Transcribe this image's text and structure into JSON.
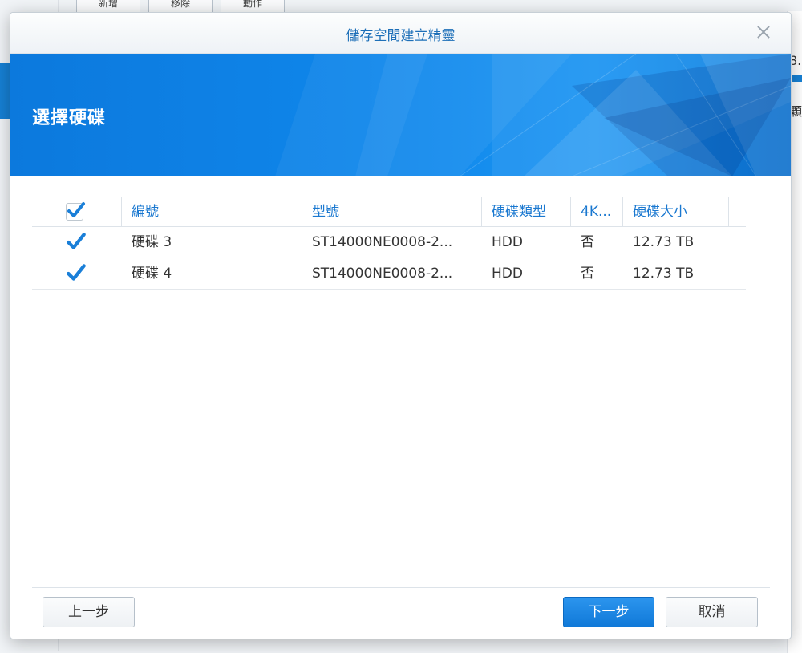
{
  "background": {
    "toolbar_buttons": [
      "新增",
      "移除",
      "動作"
    ],
    "right_text_1": "8.",
    "right_text_2": "顆"
  },
  "dialog": {
    "title": "儲存空間建立精靈",
    "close_icon": "close-icon",
    "banner_title": "選擇硬碟",
    "accent_color": "#1680d4"
  },
  "table": {
    "select_all_checked": true,
    "columns": [
      "編號",
      "型號",
      "硬碟類型",
      "4K...",
      "硬碟大小"
    ],
    "rows": [
      {
        "checked": true,
        "id": "硬碟 3",
        "model": "ST14000NE0008-2...",
        "type": "HDD",
        "native4k": "否",
        "size": "12.73 TB"
      },
      {
        "checked": true,
        "id": "硬碟 4",
        "model": "ST14000NE0008-2...",
        "type": "HDD",
        "native4k": "否",
        "size": "12.73 TB"
      }
    ]
  },
  "footer": {
    "back_label": "上一步",
    "next_label": "下一步",
    "cancel_label": "取消"
  }
}
